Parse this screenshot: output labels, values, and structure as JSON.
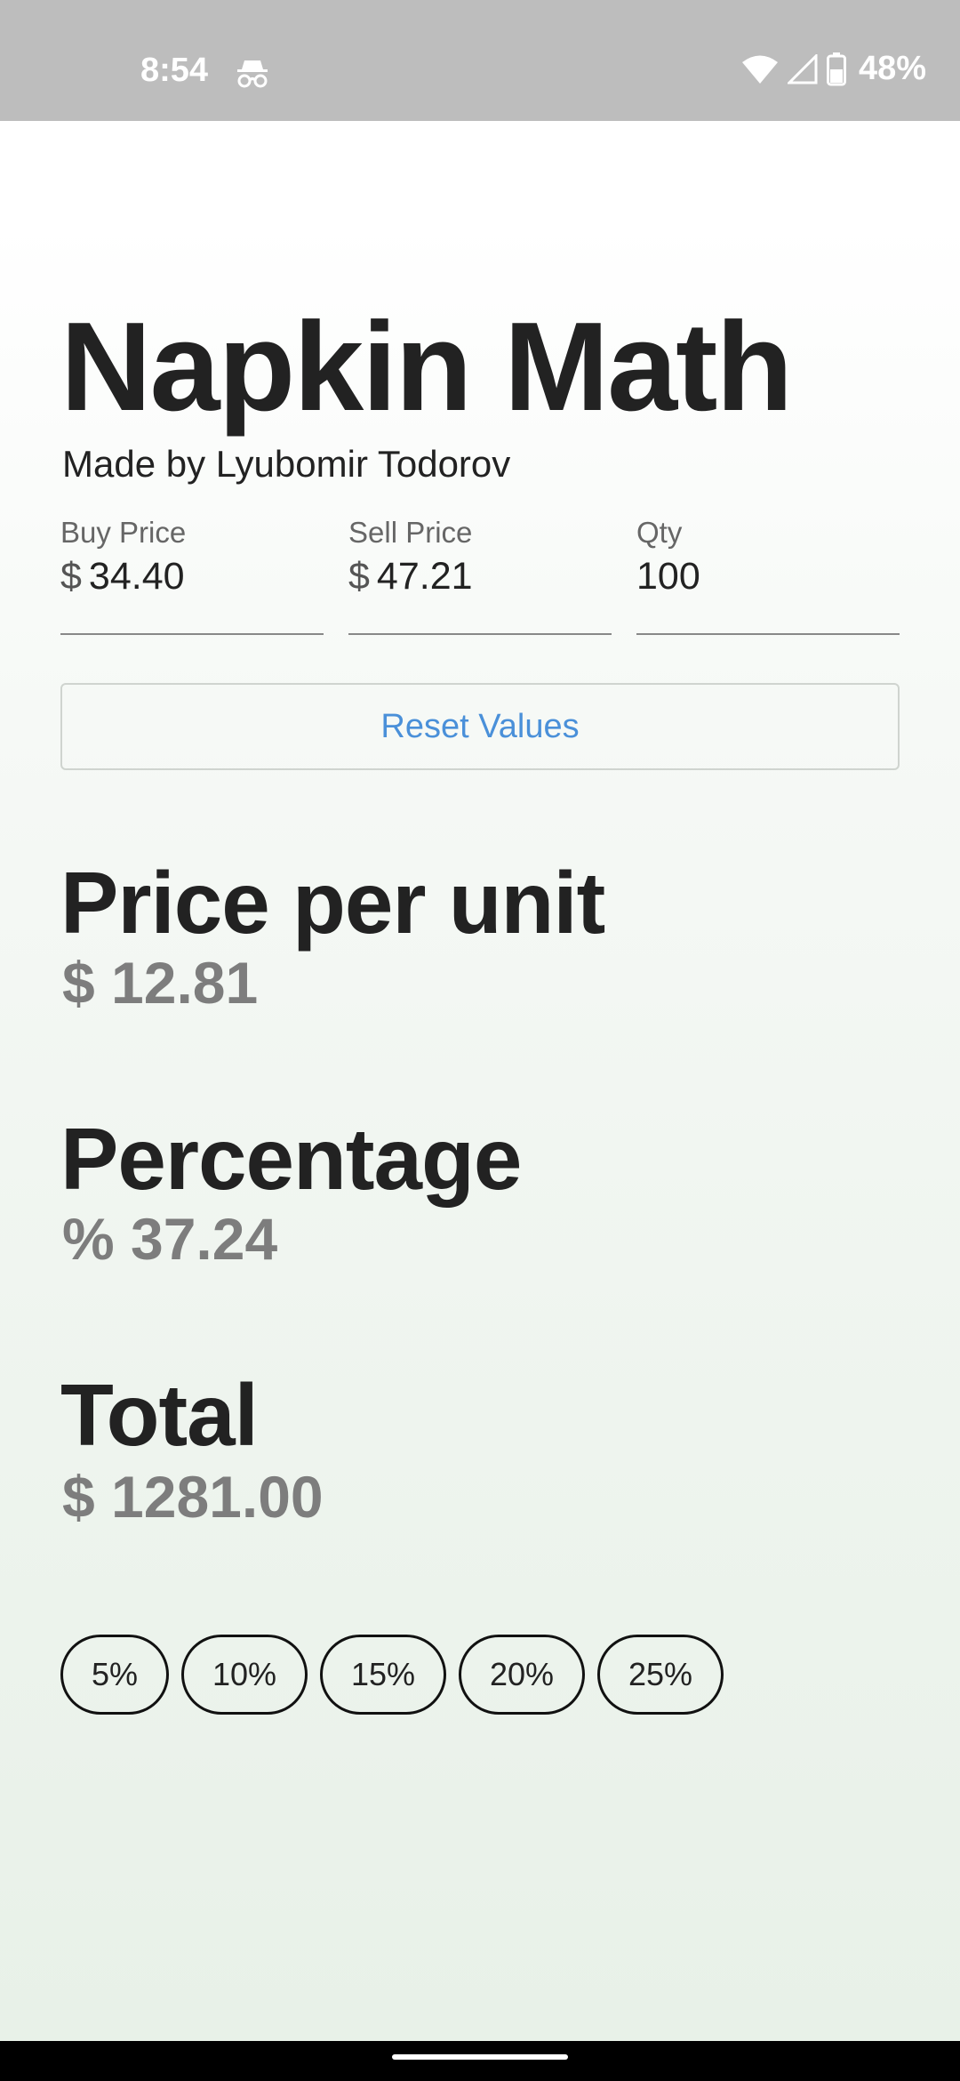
{
  "status_bar": {
    "time": "8:54",
    "battery_percent": "48%",
    "icons": [
      "incognito-icon",
      "wifi-icon",
      "signal-icon",
      "battery-icon"
    ]
  },
  "app": {
    "title": "Napkin Math",
    "subtitle": "Made by Lyubomir Todorov"
  },
  "inputs": {
    "buy_price": {
      "label": "Buy Price",
      "prefix": "$",
      "value": "34.40"
    },
    "sell_price": {
      "label": "Sell Price",
      "prefix": "$",
      "value": "47.21"
    },
    "qty": {
      "label": "Qty",
      "value": "100"
    }
  },
  "reset_button": {
    "label": "Reset Values"
  },
  "results": {
    "price_per_unit": {
      "label": "Price per unit",
      "value": "$ 12.81"
    },
    "percentage": {
      "label": "Percentage",
      "value": "% 37.24"
    },
    "total": {
      "label": "Total",
      "value": "$ 1281.00"
    }
  },
  "chips": [
    "5%",
    "10%",
    "15%",
    "20%",
    "25%"
  ],
  "colors": {
    "status_bar_bg": "#bdbdbd",
    "accent": "#4a90d9",
    "result_value": "#7d7d7d"
  }
}
